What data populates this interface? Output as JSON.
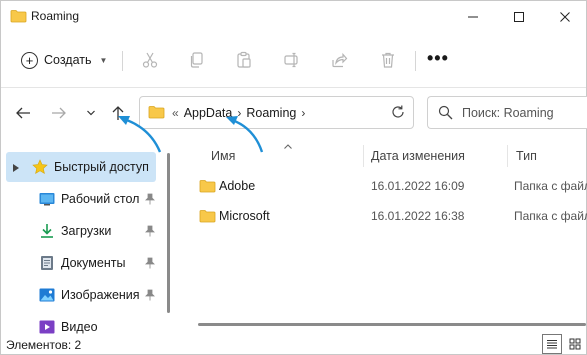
{
  "window": {
    "title": "Roaming"
  },
  "toolbar": {
    "create_label": "Создать",
    "tools": [
      "cut-icon",
      "copy-icon",
      "paste-icon",
      "rename-icon",
      "share-icon",
      "delete-icon"
    ],
    "more_label": "•••"
  },
  "address": {
    "overflow": "«",
    "crumbs": [
      "AppData",
      "Roaming"
    ]
  },
  "search": {
    "placeholder": "Поиск: Roaming"
  },
  "sidebar": {
    "items": [
      {
        "label": "Быстрый доступ",
        "icon": "star-icon"
      },
      {
        "label": "Рабочий стол",
        "icon": "desktop-icon"
      },
      {
        "label": "Загрузки",
        "icon": "download-icon"
      },
      {
        "label": "Документы",
        "icon": "documents-icon"
      },
      {
        "label": "Изображения",
        "icon": "pictures-icon"
      },
      {
        "label": "Видео",
        "icon": "video-icon"
      }
    ]
  },
  "columns": {
    "name": "Имя",
    "date": "Дата изменения",
    "type": "Тип"
  },
  "files": [
    {
      "name": "Adobe",
      "date": "16.01.2022 16:09",
      "type": "Папка с файлами"
    },
    {
      "name": "Microsoft",
      "date": "16.01.2022 16:38",
      "type": "Папка с файлами"
    }
  ],
  "status": {
    "items_count": "Элементов: 2"
  },
  "colors": {
    "accent": "#0067c0",
    "folder": "#f8c849",
    "selection": "#cce4f7",
    "annotation": "#1f8fd6"
  }
}
